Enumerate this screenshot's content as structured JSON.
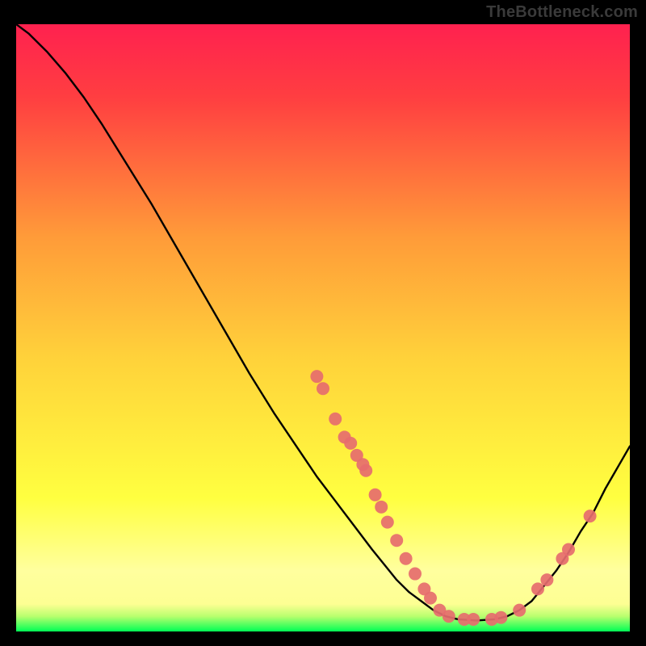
{
  "watermark": "TheBottleneck.com",
  "chart_data": {
    "type": "line",
    "title": "",
    "xlabel": "",
    "ylabel": "",
    "xlim": [
      0,
      100
    ],
    "ylim": [
      0,
      100
    ],
    "gradient": {
      "top": "#ff214f",
      "mid_upper": "#ffd23a",
      "mid_lower": "#ffff40",
      "near_bottom": "#ffff9e",
      "bottom": "#00ff55"
    },
    "curve": [
      {
        "x": 0.0,
        "y": 100.0
      },
      {
        "x": 2.0,
        "y": 98.5
      },
      {
        "x": 5.0,
        "y": 95.5
      },
      {
        "x": 8.0,
        "y": 92.0
      },
      {
        "x": 11.0,
        "y": 88.0
      },
      {
        "x": 14.0,
        "y": 83.5
      },
      {
        "x": 18.0,
        "y": 77.0
      },
      {
        "x": 22.0,
        "y": 70.5
      },
      {
        "x": 26.0,
        "y": 63.5
      },
      {
        "x": 30.0,
        "y": 56.5
      },
      {
        "x": 34.0,
        "y": 49.5
      },
      {
        "x": 38.0,
        "y": 42.5
      },
      {
        "x": 42.0,
        "y": 36.0
      },
      {
        "x": 46.0,
        "y": 30.0
      },
      {
        "x": 49.0,
        "y": 25.5
      },
      {
        "x": 52.0,
        "y": 21.5
      },
      {
        "x": 55.0,
        "y": 17.5
      },
      {
        "x": 58.0,
        "y": 13.5
      },
      {
        "x": 60.0,
        "y": 11.0
      },
      {
        "x": 62.0,
        "y": 8.5
      },
      {
        "x": 64.0,
        "y": 6.5
      },
      {
        "x": 66.0,
        "y": 5.0
      },
      {
        "x": 68.0,
        "y": 3.5
      },
      {
        "x": 70.0,
        "y": 2.5
      },
      {
        "x": 72.0,
        "y": 2.0
      },
      {
        "x": 75.0,
        "y": 1.8
      },
      {
        "x": 78.0,
        "y": 2.0
      },
      {
        "x": 80.0,
        "y": 2.5
      },
      {
        "x": 82.0,
        "y": 3.5
      },
      {
        "x": 84.0,
        "y": 5.0
      },
      {
        "x": 86.0,
        "y": 7.5
      },
      {
        "x": 88.0,
        "y": 10.0
      },
      {
        "x": 90.0,
        "y": 13.0
      },
      {
        "x": 92.0,
        "y": 16.5
      },
      {
        "x": 94.0,
        "y": 19.5
      },
      {
        "x": 96.0,
        "y": 23.5
      },
      {
        "x": 98.0,
        "y": 27.0
      },
      {
        "x": 100.0,
        "y": 30.5
      }
    ],
    "points": [
      {
        "x": 49.0,
        "y": 42.0
      },
      {
        "x": 50.0,
        "y": 40.0
      },
      {
        "x": 52.0,
        "y": 35.0
      },
      {
        "x": 53.5,
        "y": 32.0
      },
      {
        "x": 54.5,
        "y": 31.0
      },
      {
        "x": 55.5,
        "y": 29.0
      },
      {
        "x": 56.5,
        "y": 27.5
      },
      {
        "x": 57.0,
        "y": 26.5
      },
      {
        "x": 58.5,
        "y": 22.5
      },
      {
        "x": 59.5,
        "y": 20.5
      },
      {
        "x": 60.5,
        "y": 18.0
      },
      {
        "x": 62.0,
        "y": 15.0
      },
      {
        "x": 63.5,
        "y": 12.0
      },
      {
        "x": 65.0,
        "y": 9.5
      },
      {
        "x": 66.5,
        "y": 7.0
      },
      {
        "x": 67.5,
        "y": 5.5
      },
      {
        "x": 69.0,
        "y": 3.5
      },
      {
        "x": 70.5,
        "y": 2.5
      },
      {
        "x": 73.0,
        "y": 2.0
      },
      {
        "x": 74.5,
        "y": 2.0
      },
      {
        "x": 77.5,
        "y": 2.0
      },
      {
        "x": 79.0,
        "y": 2.3
      },
      {
        "x": 82.0,
        "y": 3.5
      },
      {
        "x": 85.0,
        "y": 7.0
      },
      {
        "x": 86.5,
        "y": 8.5
      },
      {
        "x": 89.0,
        "y": 12.0
      },
      {
        "x": 90.0,
        "y": 13.5
      },
      {
        "x": 93.5,
        "y": 19.0
      }
    ],
    "point_color": "#e66d6e",
    "curve_color": "#000000"
  }
}
